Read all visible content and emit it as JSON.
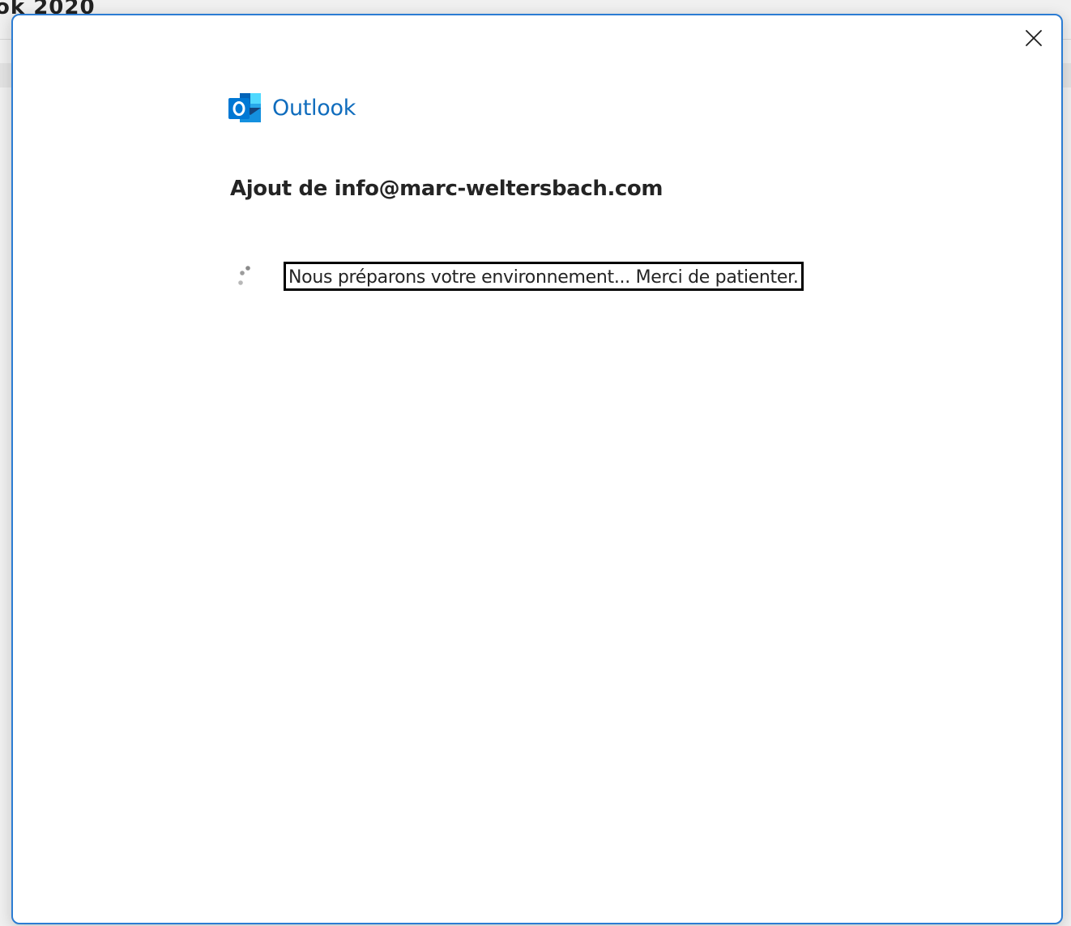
{
  "background": {
    "partial_title": "ok   2020"
  },
  "dialog": {
    "close_icon": "close-icon",
    "brand": {
      "icon": "outlook-logo-icon",
      "name": "Outlook",
      "accent_color": "#0f6cbd"
    },
    "heading": "Ajout de info@marc-weltersbach.com",
    "spinner_icon": "loading-spinner-icon",
    "status_message": "Nous préparons votre environnement... Merci de patienter."
  },
  "colors": {
    "dialog_border": "#2b7cd3",
    "text": "#242424"
  }
}
